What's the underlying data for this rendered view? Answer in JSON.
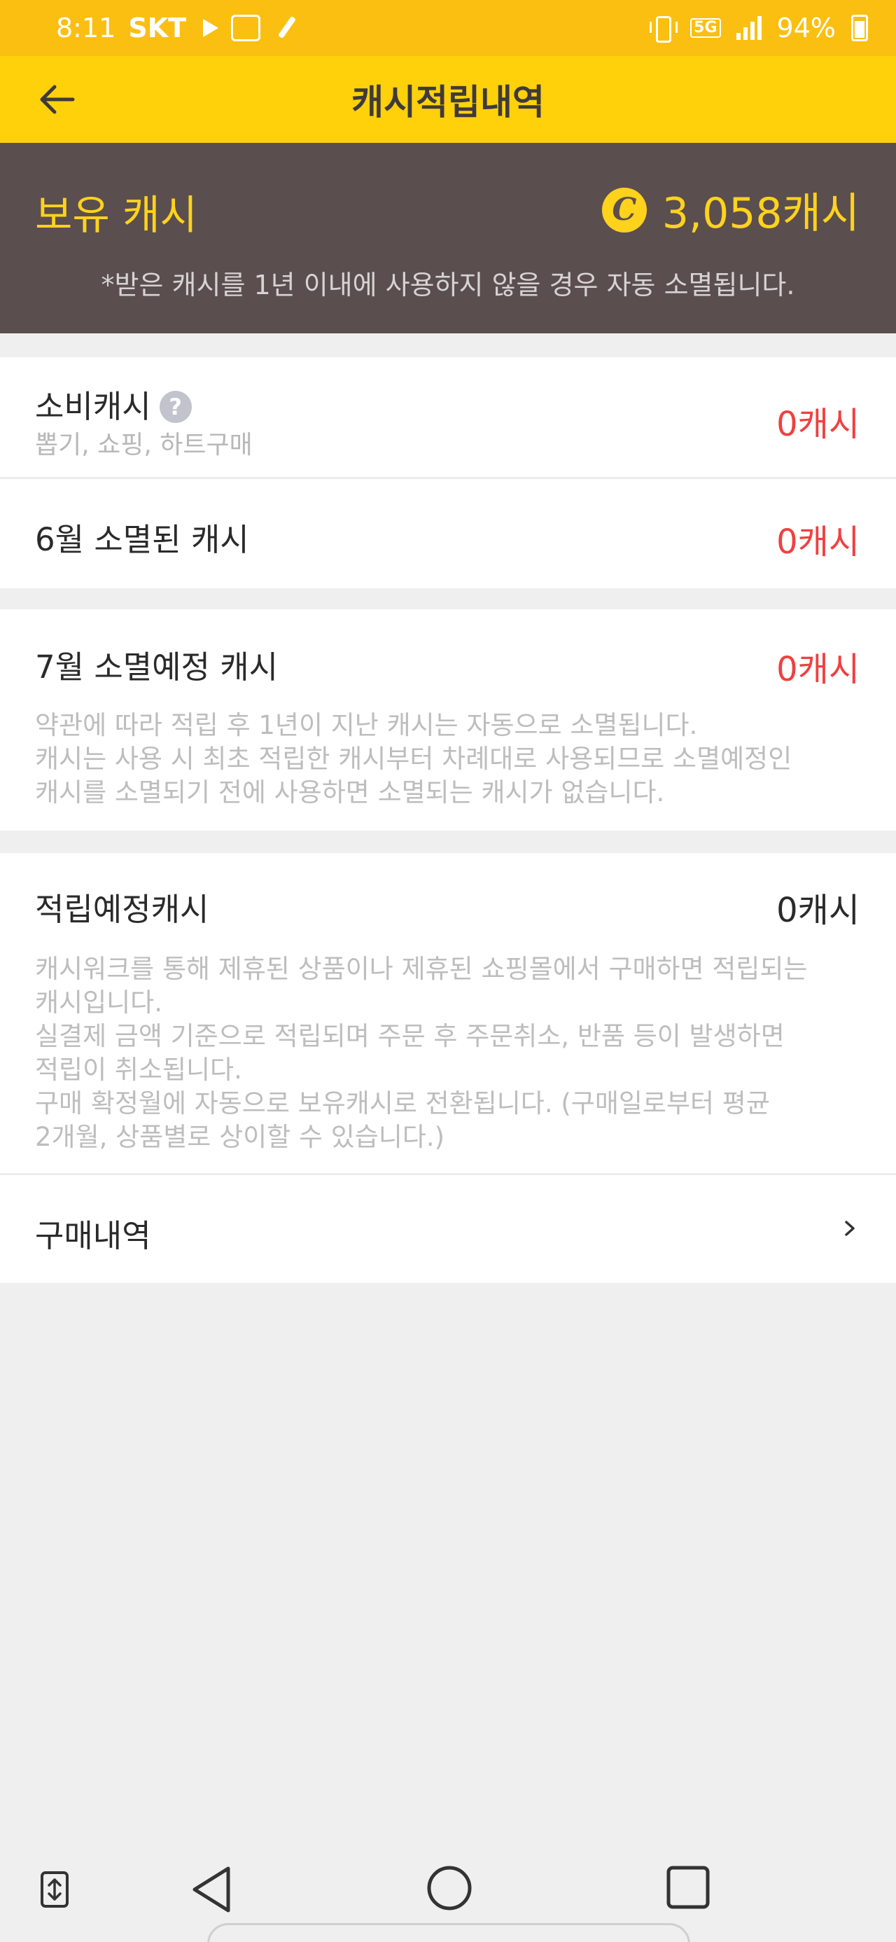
{
  "status_bar": {
    "time": "8:11",
    "carrier": "SKT",
    "network": "5G",
    "battery": "94%"
  },
  "header": {
    "title": "캐시적립내역"
  },
  "balance": {
    "label": "보유 캐시",
    "coin_symbol": "C",
    "amount": "3,058캐시",
    "note": "*받은 캐시를 1년 이내에 사용하지 않을 경우 자동 소멸됩니다."
  },
  "spent": {
    "title": "소비캐시",
    "subtitle": "뽑기, 쇼핑, 하트구매",
    "value": "0캐시"
  },
  "expired": {
    "title": "6월 소멸된 캐시",
    "value": "0캐시"
  },
  "expiring": {
    "title": "7월 소멸예정 캐시",
    "value": "0캐시",
    "description": [
      "약관에 따라 적립 후 1년이 지난 캐시는 자동으로 소멸됩니다.",
      "캐시는 사용 시 최초 적립한 캐시부터 차례대로 사용되므로 소멸예정인",
      "캐시를 소멸되기 전에 사용하면 소멸되는 캐시가 없습니다."
    ]
  },
  "pending": {
    "title": "적립예정캐시",
    "value": "0캐시",
    "description": [
      "캐시워크를 통해 제휴된 상품이나 제휴된 쇼핑몰에서 구매하면 적립되는",
      "캐시입니다.",
      "실결제 금액 기준으로 적립되며 주문 후 주문취소, 반품 등이 발생하면",
      "적립이 취소됩니다.",
      "구매 확정월에 자동으로 보유캐시로 전환됩니다. (구매일로부터 평균",
      "2개월, 상품별로 상이할 수 있습니다.)"
    ]
  },
  "purchase_history": {
    "label": "구매내역"
  },
  "colors": {
    "status_bar": "#fbbf12",
    "app_bar": "#ffd10b",
    "balance_bg": "#5b4e4f",
    "accent_yellow": "#ffd21c",
    "value_red": "#f04040"
  }
}
